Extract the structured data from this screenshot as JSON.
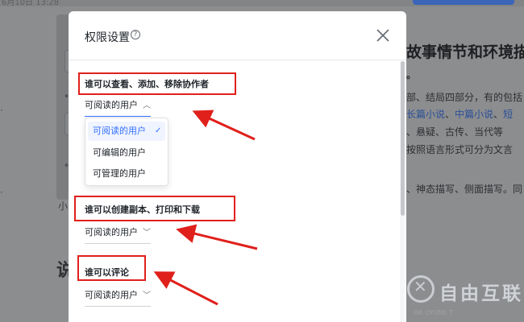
{
  "background": {
    "date_fragment": "6月10日 13:28",
    "right_column": [
      "故事情节和环境描写",
      "。",
      "部、结局四部分，有的包括",
      [
        "长篇小说",
        "、",
        "中篇小说",
        "、",
        "短"
      ],
      "、悬疑、古传、当代等",
      "按照语言形式可分为文言",
      "、神态描写、侧面描写。同"
    ],
    "left_fragment": "小",
    "big_char": "说"
  },
  "dialog": {
    "title": "权限设置",
    "help_icon": "?",
    "sections": [
      {
        "label": "谁可以查看、添加、移除协作者",
        "selected": "可阅读的用户",
        "expanded": true,
        "options": [
          "可阅读的用户",
          "可编辑的用户",
          "可管理的用户"
        ]
      },
      {
        "label": "谁可以创建副本、打印和下载",
        "selected": "可阅读的用户",
        "expanded": false
      },
      {
        "label": "谁可以评论",
        "selected": "可阅读的用户",
        "expanded": false
      }
    ]
  },
  "watermark": {
    "text": "自由互联",
    "sub": "HA  OYUNE  T"
  },
  "colors": {
    "accent": "#3370ff",
    "annotation": "#e0201b"
  }
}
